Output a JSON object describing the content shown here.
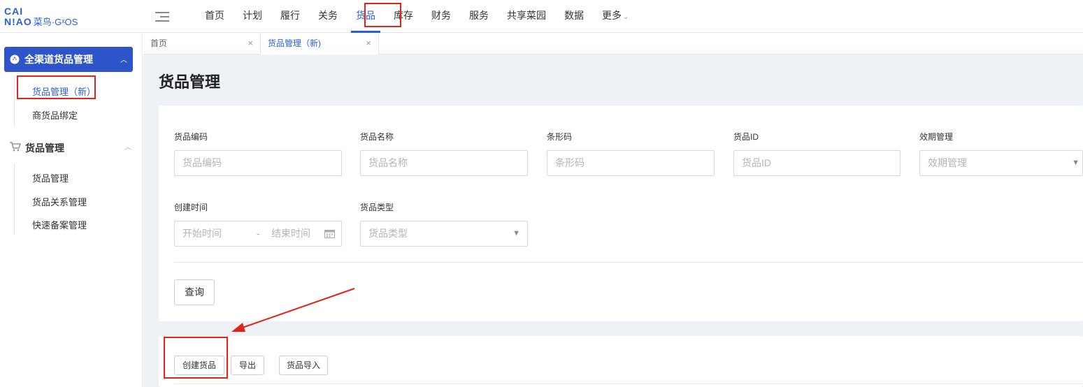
{
  "logo": {
    "line1": "CAI",
    "line2_prefix": "N!AO",
    "line2_rest": "菜鸟·GˣOS"
  },
  "nav": {
    "items": [
      "首页",
      "计划",
      "履行",
      "关务",
      "货品",
      "库存",
      "财务",
      "服务",
      "共享菜园",
      "数据",
      "更多"
    ],
    "active_index": 4,
    "more_suffix": "⌄"
  },
  "sidebar": {
    "active_group": "全渠道货品管理",
    "active_group_items": [
      "货品管理（新）",
      "商货品绑定"
    ],
    "group2": "货品管理",
    "group2_items": [
      "货品管理",
      "货品关系管理",
      "快速备案管理"
    ]
  },
  "tabs": [
    {
      "label": "首页",
      "close": "×"
    },
    {
      "label": "货品管理（新)",
      "close": "×"
    }
  ],
  "page": {
    "title": "货品管理"
  },
  "filters": {
    "code": {
      "label": "货品编码",
      "placeholder": "货品编码"
    },
    "name": {
      "label": "货品名称",
      "placeholder": "货品名称"
    },
    "barcode": {
      "label": "条形码",
      "placeholder": "条形码"
    },
    "id": {
      "label": "货品ID",
      "placeholder": "货品ID"
    },
    "expiry": {
      "label": "效期管理",
      "placeholder": "效期管理"
    },
    "created": {
      "label": "创建时间",
      "start": "开始时间",
      "sep": "-",
      "end": "结束时间"
    },
    "type": {
      "label": "货品类型",
      "placeholder": "货品类型"
    }
  },
  "buttons": {
    "query": "查询",
    "create": "创建货品",
    "export": "导出",
    "import": "货品导入"
  },
  "colors": {
    "brand": "#2b5fd9",
    "annotation": "#e0241b",
    "sidebar_active_bg": "#2d55c9"
  }
}
